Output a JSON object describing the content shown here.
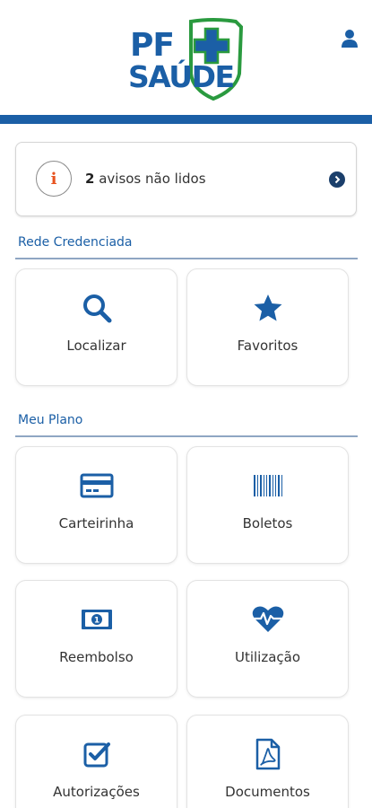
{
  "header": {
    "logo_line1": "PF",
    "logo_line2": "SAÚDE",
    "brand_color": "#1b5fa6",
    "accent_color": "#2a9a3f"
  },
  "notice": {
    "icon": "info-icon",
    "count": "2",
    "text": " avisos não lidos"
  },
  "sections": {
    "rede": {
      "title": "Rede Credenciada",
      "items": [
        {
          "label": "Localizar",
          "icon": "search-icon"
        },
        {
          "label": "Favoritos",
          "icon": "star-icon"
        }
      ]
    },
    "plano": {
      "title": "Meu Plano",
      "items": [
        {
          "label": "Carteirinha",
          "icon": "card-icon"
        },
        {
          "label": "Boletos",
          "icon": "barcode-icon"
        },
        {
          "label": "Reembolso",
          "icon": "money-icon"
        },
        {
          "label": "Utilização",
          "icon": "heart-pulse-icon"
        },
        {
          "label": "Autorizações",
          "icon": "check-square-icon"
        },
        {
          "label": "Documentos",
          "icon": "pdf-file-icon"
        }
      ]
    }
  }
}
